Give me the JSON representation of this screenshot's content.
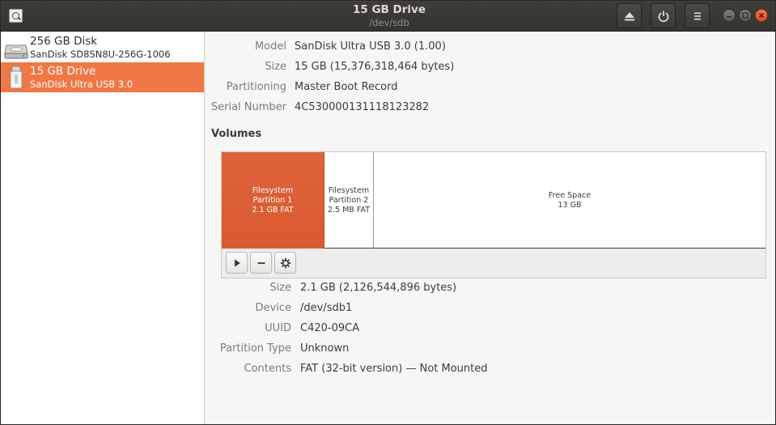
{
  "window": {
    "title": "15 GB Drive",
    "subtitle": "/dev/sdb"
  },
  "header_buttons": {
    "eject": "eject-icon",
    "power": "power-icon",
    "menu": "hamburger-menu-icon"
  },
  "sidebar": {
    "drives": [
      {
        "name": "256 GB Disk",
        "model": "SanDisk SD8SN8U-256G-1006",
        "icon": "hard-disk-icon",
        "selected": false
      },
      {
        "name": "15 GB Drive",
        "model": "SanDisk Ultra USB 3.0",
        "icon": "usb-drive-icon",
        "selected": true
      }
    ]
  },
  "drive_info": [
    {
      "label": "Model",
      "value": "SanDisk Ultra USB 3.0 (1.00)"
    },
    {
      "label": "Size",
      "value": "15 GB (15,376,318,464 bytes)"
    },
    {
      "label": "Partitioning",
      "value": "Master Boot Record"
    },
    {
      "label": "Serial Number",
      "value": "4C530000131118123282"
    }
  ],
  "volumes": {
    "heading": "Volumes",
    "partitions": [
      {
        "line1": "Filesystem",
        "line2": "Partition 1",
        "line3": "2.1 GB FAT",
        "selected": true
      },
      {
        "line1": "Filesystem",
        "line2": "Partition 2",
        "line3": "2.5 MB FAT",
        "selected": false
      },
      {
        "line1": "Free Space",
        "line2": "13 GB",
        "selected": false
      }
    ],
    "tools": [
      "play-icon",
      "minus-icon",
      "gear-icon"
    ]
  },
  "volume_info": [
    {
      "label": "Size",
      "value": "2.1 GB (2,126,544,896 bytes)"
    },
    {
      "label": "Device",
      "value": "/dev/sdb1"
    },
    {
      "label": "UUID",
      "value": "C420-09CA"
    },
    {
      "label": "Partition Type",
      "value": "Unknown"
    },
    {
      "label": "Contents",
      "value": "FAT (32-bit version) — Not Mounted"
    }
  ],
  "colors": {
    "accent": "#f07746",
    "partition_selected": "#dd5f35",
    "headerbar": "#3a3935"
  }
}
